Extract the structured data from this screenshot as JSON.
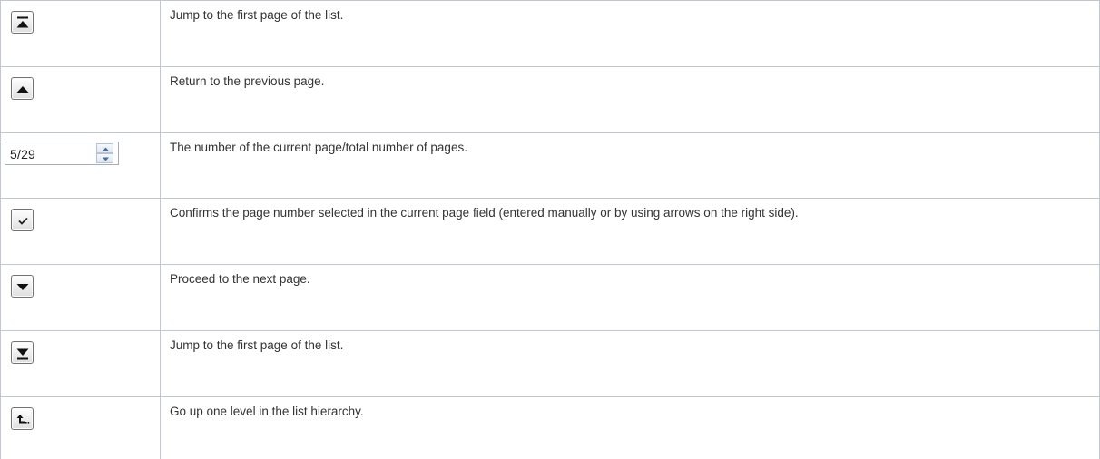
{
  "rows": [
    {
      "icon": "first-page-icon",
      "text": "Jump to the first page of the list."
    },
    {
      "icon": "previous-page-icon",
      "text": "Return to the previous page."
    },
    {
      "icon": "page-number-spinner",
      "text": "The number of the current page/total number of pages."
    },
    {
      "icon": "checkmark-icon",
      "text": "Confirms the page number selected in the current page field (entered manually or by using arrows on the right side)."
    },
    {
      "icon": "next-page-icon",
      "text": "Proceed to the next page."
    },
    {
      "icon": "last-page-icon",
      "text": "Jump to the first page of the list."
    },
    {
      "icon": "level-up-icon",
      "text": "Go up one level in the list hierarchy."
    }
  ],
  "page_field": {
    "value": "5/29"
  },
  "colors": {
    "border": "#c1c7d0",
    "text": "#333333",
    "icon": "#111111"
  }
}
